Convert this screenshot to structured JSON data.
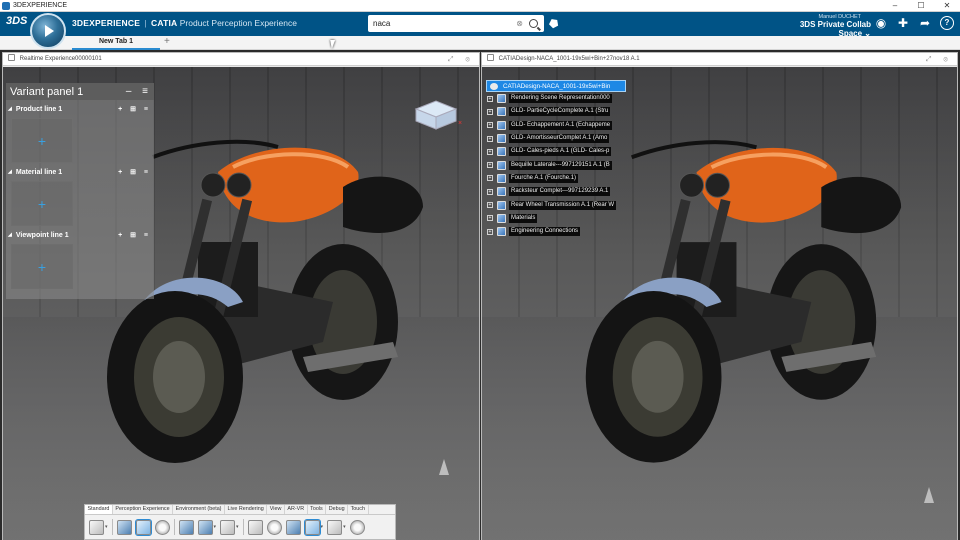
{
  "os_window": {
    "title": "3DEXPERIENCE",
    "controls": [
      "–",
      "☐",
      "✕"
    ]
  },
  "header": {
    "logo": "3DS",
    "brand_bold": "3DEXPERIENCE",
    "brand_separator": "|",
    "brand_catia": "CATIA",
    "app_name": "Product Perception Experience",
    "search_value": "naca",
    "search_clear": "⊗",
    "user_name": "Manuel DUCHET",
    "collab_space": "3DS Private Collab Space",
    "collab_caret": "⌄",
    "icons": [
      "user-circle-icon",
      "plus-icon",
      "share-icon",
      "help-icon"
    ],
    "help_label": "?"
  },
  "tabs": {
    "active": "New Tab 1",
    "add": "+"
  },
  "left_pane": {
    "title": "Realtime Experience00000101",
    "controls": "⤢ ⊗",
    "variant_panel": {
      "title": "Variant panel 1",
      "actions": "– ≡",
      "lines": [
        {
          "label": "Product line 1",
          "actions": "+ ⊞ ≡",
          "slot": "+"
        },
        {
          "label": "Material line 1",
          "actions": "+ ⊞ ≡",
          "slot": "+"
        },
        {
          "label": "Viewpoint line 1",
          "actions": "+ ⊞ ≡",
          "slot": "+"
        }
      ]
    },
    "action_bar": {
      "tabs": [
        "Standard",
        "Perception Experience",
        "Environment (beta)",
        "Live Rendering",
        "View",
        "AR-VR",
        "Tools",
        "Debug",
        "Touch"
      ],
      "active_tab": "Standard"
    }
  },
  "right_pane": {
    "title": "CATIADesign-NACA_1001-19x5wi+Bin+27nov18 A.1",
    "controls": "⤢ ⊗",
    "tree_root": "CATIADesign-NACA_1001-19x5wi+Bin",
    "tree_nodes": [
      "Rendering Scene Representation000",
      "GLD- PartieCycleComplete A.1 (Stru",
      "GLD- Echappement A.1 (Echappeme",
      "GLD- AmortisseurComplet A.1 (Amo",
      "GLD- Cales-pieds A.1 (GLD- Cales-p",
      "Bequille Laterale---997129151 A.1 (B",
      "Fourche A.1 (Fourche.1)",
      "Racksteur Complet---997129239 A.1",
      "Rear Wheel Transmission A.1 (Rear W",
      "Materials",
      "Engineering Connections"
    ]
  },
  "colors": {
    "header_bg": "#005386",
    "accent": "#2a8bd0",
    "selection": "#1e88e5",
    "bike_orange": "#e0641a"
  }
}
